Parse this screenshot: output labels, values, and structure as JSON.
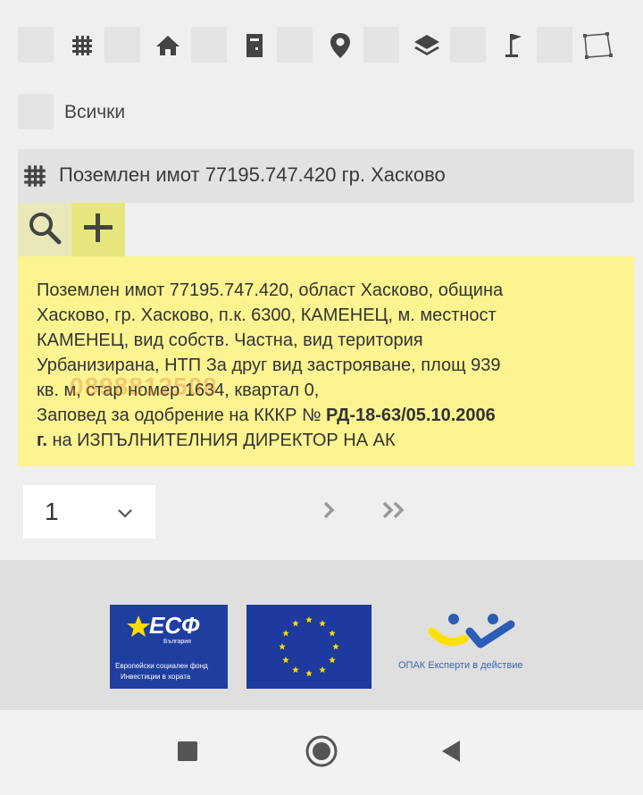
{
  "filters": {
    "items": [
      {
        "icon": "grid-icon"
      },
      {
        "icon": "home-icon"
      },
      {
        "icon": "building-icon"
      },
      {
        "icon": "map-pin-icon"
      },
      {
        "icon": "layers-icon"
      },
      {
        "icon": "flag-icon"
      },
      {
        "icon": "polygon-icon"
      }
    ]
  },
  "all_filter": {
    "label": "Всички"
  },
  "result": {
    "title": "Поземлен имот 77195.747.420 гр. Хасково",
    "icon": "grid-icon",
    "tools": [
      {
        "icon": "magnifier-icon"
      },
      {
        "icon": "plus-icon"
      }
    ],
    "detail": {
      "line1": "Поземлен имот 77195.747.420, област Хасково, община",
      "line2": "Хасково, гр. Хасково, п.к. 6300, КАМЕНЕЦ, м. местност",
      "line3": "КАМЕНЕЦ, вид собств. Частна, вид територия",
      "line4": "Урбанизирана, НТП За друг вид застрояване, площ 939",
      "line5": "кв. м, стар номер 1634, квартал 0,",
      "line6_prefix": "Заповед за одобрение на КККР № ",
      "order_number": "РД-18-63/05.10.2006",
      "line7_bold": "г.",
      "line7_rest": " на ИЗПЪЛНИТЕЛНИЯ ДИРЕКТОР НА АК"
    },
    "watermark": "0898812508"
  },
  "pagination": {
    "current_page": "1",
    "next_icon": "chevron-right-icon",
    "last_icon": "double-chevron-right-icon"
  },
  "footer": {
    "esf_logo_text": "ЕСФ",
    "esf_country": "България",
    "esf_line1": "Европейски социален фонд",
    "esf_line2": "Инвестиции в хората",
    "opak_text": "ОПАК Експерти в действие"
  },
  "colors": {
    "highlight": "#fbf490",
    "tool_active": "#e6e67e",
    "eu_blue": "#1d3a9e",
    "eu_star": "#ffdd00",
    "opak_yellow": "#ffe000",
    "opak_blue": "#2a5cb8"
  }
}
